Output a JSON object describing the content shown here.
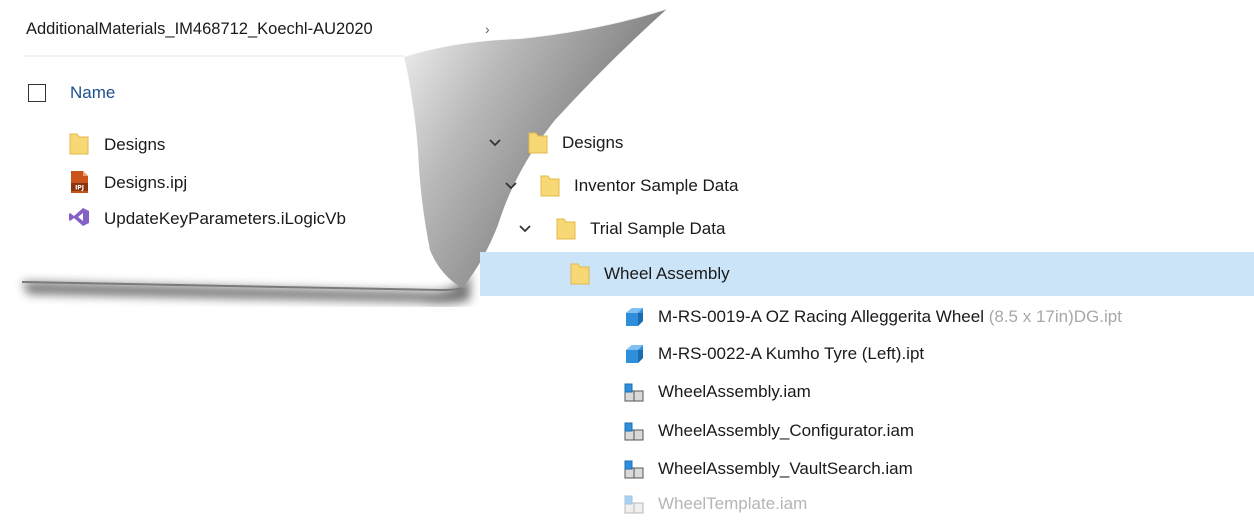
{
  "left_explorer": {
    "breadcrumb": "AdditionalMaterials_IM468712_Koechl-AU2020",
    "breadcrumb_chevron": "›",
    "column_header": "Name",
    "items": [
      {
        "name": "Designs",
        "icon": "folder-icon"
      },
      {
        "name": "Designs.ipj",
        "icon": "inventor-project-icon"
      },
      {
        "name": "UpdateKeyParameters.iLogicVb",
        "icon": "visual-studio-icon"
      }
    ]
  },
  "tree": {
    "rows": [
      {
        "label": "Designs",
        "icon": "folder-icon",
        "expanded": true
      },
      {
        "label": "Inventor Sample Data",
        "icon": "folder-icon",
        "expanded": true
      },
      {
        "label": "Trial Sample Data",
        "icon": "folder-icon",
        "expanded": true
      },
      {
        "label": "Wheel Assembly",
        "icon": "folder-icon",
        "selected": true
      },
      {
        "label": "M-RS-0019-A OZ Racing Alleggerita Wheel (8.5 x 17in)DG.ipt",
        "label_main": "M-RS-0019-A OZ Racing Alleggerita Wheel",
        "label_tail": " (8.5 x 17in)DG.ipt",
        "icon": "part-file-icon"
      },
      {
        "label": "M-RS-0022-A Kumho Tyre (Left).ipt",
        "icon": "part-file-icon"
      },
      {
        "label": "WheelAssembly.iam",
        "icon": "assembly-file-icon"
      },
      {
        "label": "WheelAssembly_Configurator.iam",
        "icon": "assembly-file-icon"
      },
      {
        "label": "WheelAssembly_VaultSearch.iam",
        "icon": "assembly-file-icon"
      },
      {
        "label": "WheelTemplate.iam",
        "icon": "assembly-file-icon",
        "dimmed": true
      }
    ]
  },
  "colors": {
    "selection": "#cce4f7",
    "folder": "#f8d775",
    "link_blue": "#1e4f8f",
    "part_blue": "#2f8fdd",
    "vs_purple": "#8661c5",
    "ipj_orange": "#c9531a"
  }
}
